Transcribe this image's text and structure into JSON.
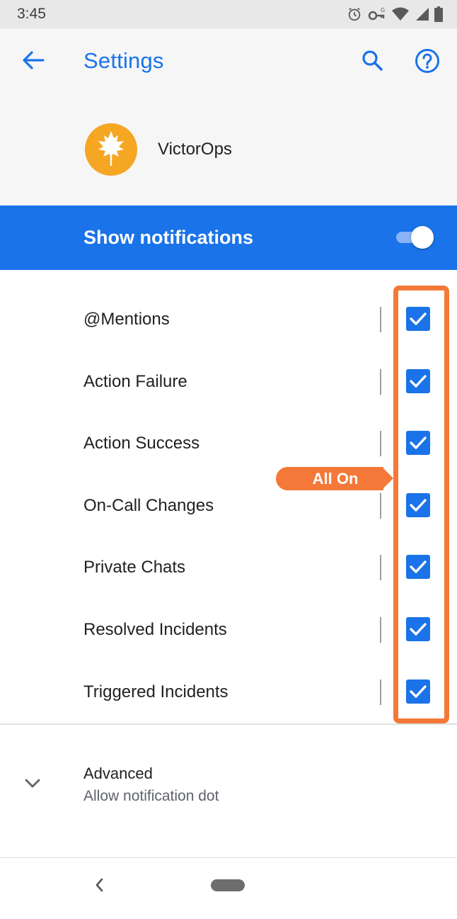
{
  "status_bar": {
    "time": "3:45",
    "icons": [
      "alarm-icon",
      "vpn-key-icon",
      "wifi-icon",
      "cell-signal-icon",
      "battery-icon"
    ]
  },
  "header": {
    "title": "Settings",
    "back_icon": "arrow-back-icon",
    "search_icon": "search-icon",
    "help_icon": "help-icon"
  },
  "app": {
    "name": "VictorOps",
    "icon": "victorops-leaf-logo",
    "icon_color": "#f5a623"
  },
  "notifications": {
    "label": "Show notifications",
    "enabled": true,
    "accent_color": "#1a73e8"
  },
  "channels": [
    {
      "label": "@Mentions",
      "checked": true
    },
    {
      "label": "Action Failure",
      "checked": true
    },
    {
      "label": "Action Success",
      "checked": true
    },
    {
      "label": "On-Call Changes",
      "checked": true
    },
    {
      "label": "Private Chats",
      "checked": true
    },
    {
      "label": "Resolved Incidents",
      "checked": true
    },
    {
      "label": "Triggered Incidents",
      "checked": true
    }
  ],
  "annotation": {
    "label": "All On",
    "color": "#f47938"
  },
  "advanced": {
    "title": "Advanced",
    "subtitle": "Allow notification dot",
    "icon": "chevron-down-icon"
  },
  "nav_bar": {
    "back_icon": "nav-back-icon",
    "home_icon": "home-pill-icon"
  }
}
